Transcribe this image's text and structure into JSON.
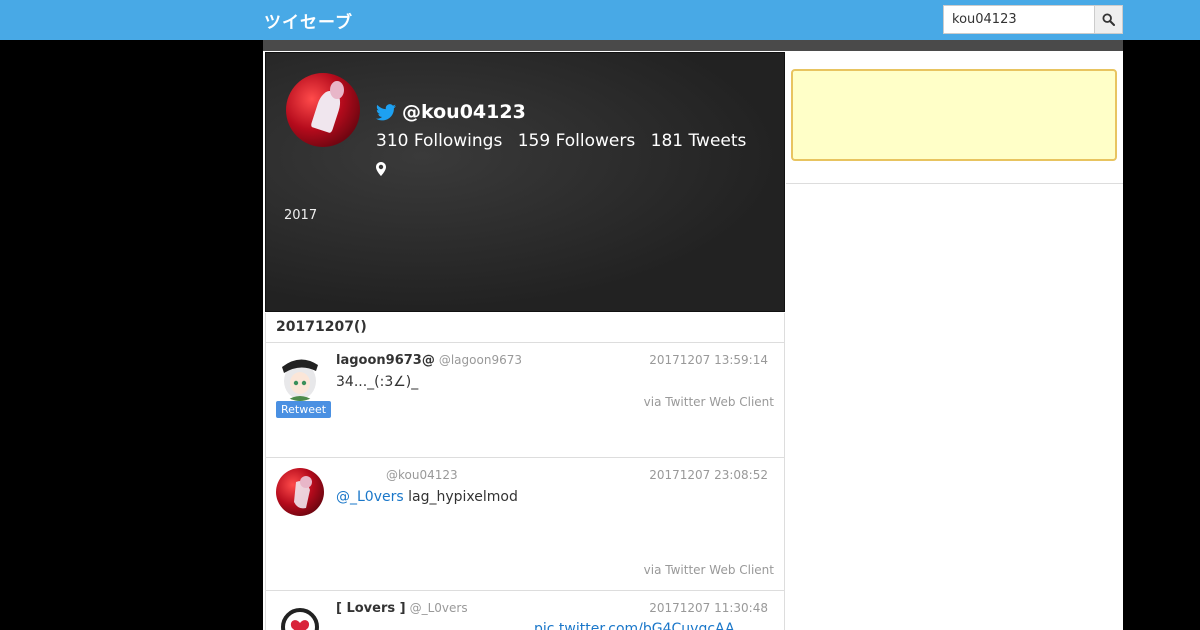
{
  "header": {
    "logo": "ツイセーブ",
    "search_value": "kou04123",
    "search_placeholder": ""
  },
  "profile": {
    "handle": "@kou04123",
    "followings": "310 Followings",
    "followers": "159 Followers",
    "tweets": "181 Tweets",
    "year": "2017"
  },
  "date_header": "20171207()",
  "tweets": [
    {
      "name": "lagoon9673@",
      "handle": "@lagoon9673",
      "time": "20171207 13:59:14",
      "text": "34..._(:3∠)_",
      "via": "via Twitter Web Client",
      "badge": "Retweet"
    },
    {
      "name": "",
      "handle": "@kou04123",
      "time": "20171207 23:08:52",
      "mention": "@_L0vers",
      "text": " lag_hypixelmod",
      "via": "via Twitter Web Client"
    },
    {
      "name": "[ Lovers ]",
      "handle": "@_L0vers",
      "time": "20171207 11:30:48",
      "link": "pic.twitter.com/bG4CuvgcAA"
    }
  ],
  "colors": {
    "header_bg": "#48a9e6",
    "link": "#1a77c9",
    "retweet_badge": "#4a90e2",
    "ad_bg": "#ffffc8"
  }
}
